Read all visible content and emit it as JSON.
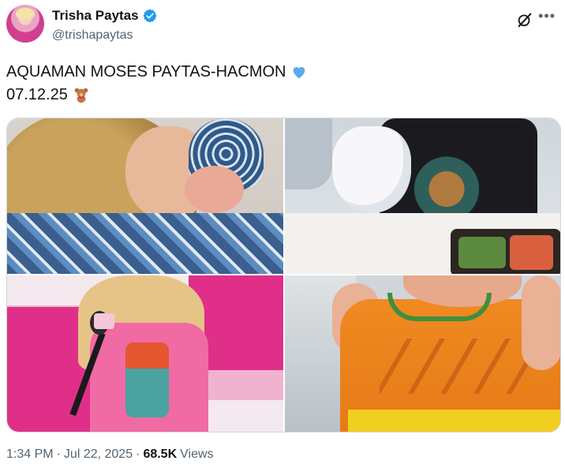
{
  "author": {
    "display_name": "Trisha Paytas",
    "handle": "@trishapaytas",
    "verified_badge_color": "#1d9bf0"
  },
  "icons": {
    "avatar": "avatar",
    "verified": "verified-badge-icon",
    "grok": "grok-icon",
    "more": "more-icon",
    "heart": "blue-heart-emoji",
    "bear": "teddy-bear-emoji"
  },
  "tweet": {
    "line1": "AQUAMAN MOSES PAYTAS-HACMON",
    "line2": "07.12.25"
  },
  "media": {
    "count": 4
  },
  "meta": {
    "time": "1:34 PM",
    "separator": "·",
    "date": "Jul 22, 2025",
    "views_count": "68.5K",
    "views_label": "Views"
  },
  "colors": {
    "text_primary": "#0f1419",
    "text_secondary": "#536471",
    "border": "#cfd9de",
    "blue_heart": "#5ea8ef"
  }
}
